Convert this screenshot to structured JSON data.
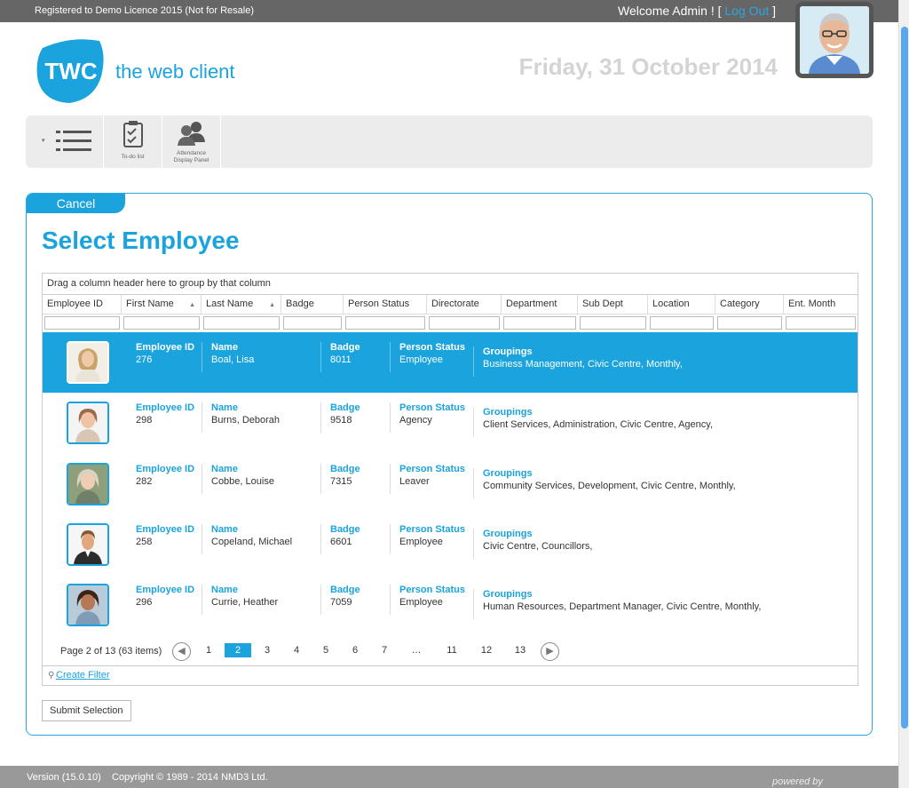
{
  "topbar": {
    "registration": "Registered to Demo Licence 2015 (Not for Resale)",
    "welcome": "Welcome Admin ! ",
    "bracket_open": "[ ",
    "logout": "Log Out",
    "bracket_close": " ]"
  },
  "brand": {
    "logo_text": "TWC",
    "name": "the web client",
    "accent": "#1aa3dc"
  },
  "date": "Friday, 31 October 2014",
  "toolbar": {
    "items": [
      {
        "label": "",
        "icon": "list-icon"
      },
      {
        "label": "To-do list",
        "icon": "clipboard-check-icon"
      },
      {
        "label_line1": "Attendance",
        "label_line2": "Display Panel",
        "icon": "users-icon"
      }
    ]
  },
  "panel": {
    "cancel_label": "Cancel",
    "title": "Select Employee",
    "group_hint": "Drag a column header here to group by that column",
    "columns": [
      "Employee ID",
      "First Name",
      "Last Name",
      "Badge",
      "Person Status",
      "Directorate",
      "Department",
      "Sub Dept",
      "Location",
      "Category",
      "Ent. Month"
    ],
    "field_labels": {
      "employee_id": "Employee ID",
      "name": "Name",
      "badge": "Badge",
      "person_status": "Person Status",
      "groupings": "Groupings"
    },
    "rows": [
      {
        "employee_id": "276",
        "name": "Boal, Lisa",
        "badge": "8011",
        "person_status": "Employee",
        "groupings": "Business Management, Civic Centre, Monthly,",
        "selected": true
      },
      {
        "employee_id": "298",
        "name": "Burns, Deborah",
        "badge": "9518",
        "person_status": "Agency",
        "groupings": "Client Services, Administration, Civic Centre, Agency,",
        "selected": false
      },
      {
        "employee_id": "282",
        "name": "Cobbe, Louise",
        "badge": "7315",
        "person_status": "Leaver",
        "groupings": "Community Services, Development, Civic Centre, Monthly,",
        "selected": false
      },
      {
        "employee_id": "258",
        "name": "Copeland, Michael",
        "badge": "6601",
        "person_status": "Employee",
        "groupings": "Civic Centre, Councillors,",
        "selected": false
      },
      {
        "employee_id": "296",
        "name": "Currie, Heather",
        "badge": "7059",
        "person_status": "Employee",
        "groupings": "Human Resources, Department Manager, Civic Centre, Monthly,",
        "selected": false
      }
    ],
    "pager": {
      "info": "Page 2 of 13 (63 items)",
      "pages": [
        "1",
        "2",
        "3",
        "4",
        "5",
        "6",
        "7",
        "…",
        "11",
        "12",
        "13"
      ],
      "current": "2"
    },
    "create_filter": "Create Filter",
    "submit_label": "Submit Selection"
  },
  "footer": {
    "version": "Version (15.0.10)",
    "copyright": "Copyright © 1989 - 2014 NMD3 Ltd.",
    "powered": "powered by"
  }
}
